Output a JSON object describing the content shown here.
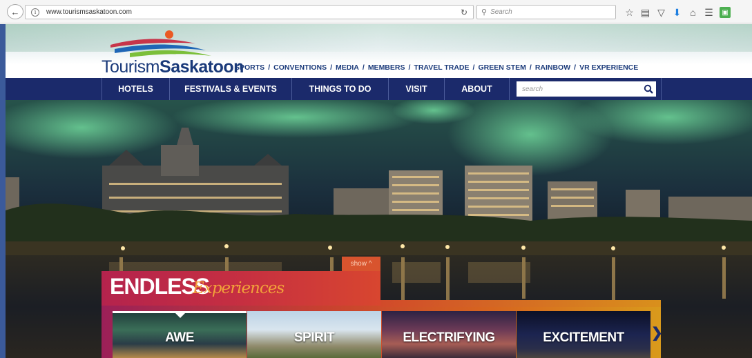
{
  "browser": {
    "url": "www.tourismsaskatoon.com",
    "search_placeholder": "Search"
  },
  "site": {
    "logo_light": "Tourism",
    "logo_bold": "Saskatoon",
    "top_nav": [
      "SPORTS",
      "CONVENTIONS",
      "MEDIA",
      "MEMBERS",
      "TRAVEL TRADE",
      "GREEN STEM",
      "RAINBOW",
      "VR EXPERIENCE"
    ],
    "main_nav": [
      "HOTELS",
      "FESTIVALS & EVENTS",
      "THINGS TO DO",
      "VISIT",
      "ABOUT"
    ],
    "search_placeholder": "search"
  },
  "promo": {
    "show_label": "show ^",
    "title_bold": "ENDLESS",
    "title_script": "Experiences",
    "tiles": [
      "AWE",
      "SPIRIT",
      "ELECTRIFYING",
      "EXCITEMENT"
    ]
  }
}
